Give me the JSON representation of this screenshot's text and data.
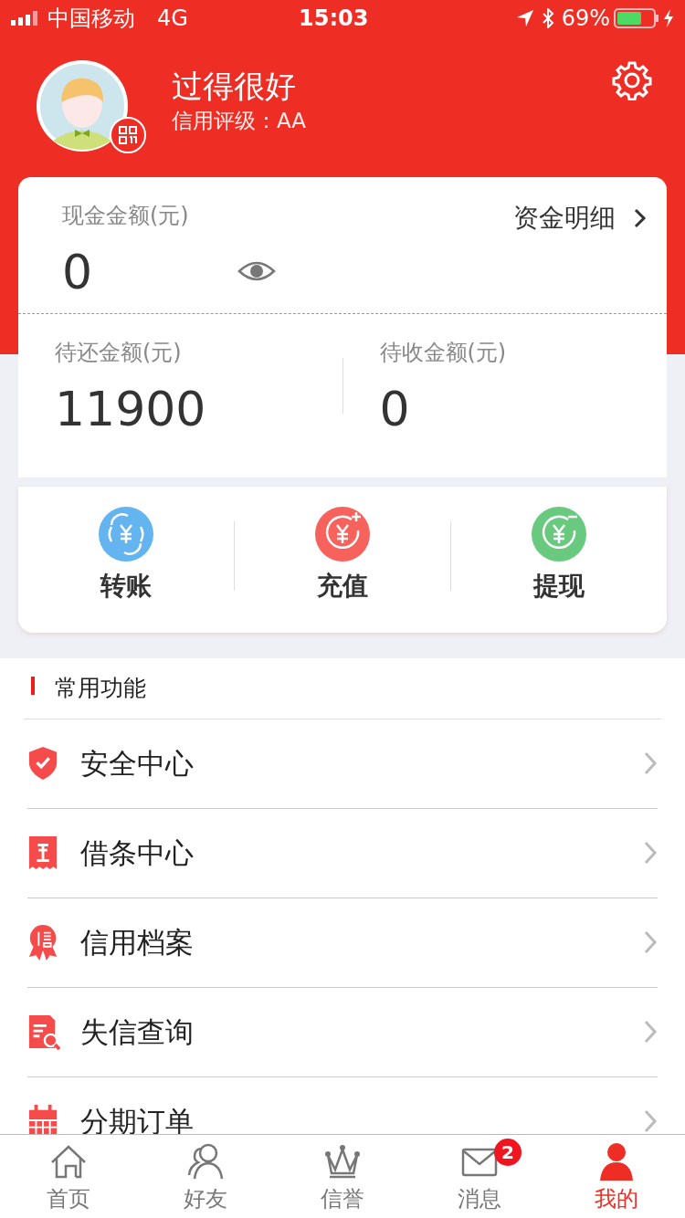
{
  "status_bar": {
    "carrier": "中国移动",
    "network": "4G",
    "time": "15:03",
    "battery": "69%"
  },
  "profile": {
    "name": "过得很好",
    "rating": "信用评级：AA"
  },
  "balance": {
    "label": "现金金额(元)",
    "value": "0",
    "link": "资金明细",
    "sub": [
      {
        "label": "待还金额(元)",
        "value": "11900"
      },
      {
        "label": "待收金额(元)",
        "value": "0"
      }
    ]
  },
  "actions": [
    {
      "label": "转账",
      "kind": "transfer",
      "color": "#63b4ef"
    },
    {
      "label": "充值",
      "kind": "recharge",
      "color": "#f8625c"
    },
    {
      "label": "提现",
      "kind": "withdraw",
      "color": "#68c97f"
    }
  ],
  "section_title": "常用功能",
  "menu": [
    {
      "label": "安全中心",
      "kind": "shield"
    },
    {
      "label": "借条中心",
      "kind": "receipt"
    },
    {
      "label": "信用档案",
      "kind": "badge"
    },
    {
      "label": "失信查询",
      "kind": "search-doc"
    },
    {
      "label": "分期订单",
      "kind": "calendar"
    }
  ],
  "tabs": [
    {
      "label": "首页",
      "kind": "home",
      "selected": false
    },
    {
      "label": "好友",
      "kind": "friends",
      "selected": false
    },
    {
      "label": "信誉",
      "kind": "crown",
      "selected": false
    },
    {
      "label": "消息",
      "kind": "mail",
      "selected": false,
      "badge": "2"
    },
    {
      "label": "我的",
      "kind": "person",
      "selected": true
    }
  ]
}
